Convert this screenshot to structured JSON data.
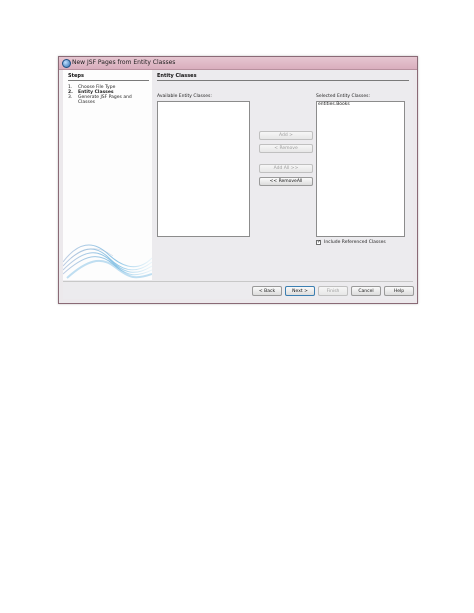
{
  "window": {
    "title": "New JSF Pages from Entity Classes"
  },
  "steps": {
    "title": "Steps",
    "items": [
      {
        "num": "1.",
        "label": "Choose File Type",
        "current": false
      },
      {
        "num": "2.",
        "label": "Entity Classes",
        "current": true
      },
      {
        "num": "3.",
        "label": "Generate JSF Pages and Classes",
        "current": false
      }
    ]
  },
  "panel": {
    "title": "Entity Classes",
    "available_label": "Available Entity Classes:",
    "available_items": [],
    "selected_label": "Selected Entity Classes:",
    "selected_items": [
      "entities.Books"
    ],
    "add_label": "Add >",
    "remove_label": "< Remove",
    "add_all_label": "Add All >>",
    "remove_all_label": "<< RemoveAll",
    "include_referenced_label": "Include Referenced Classes",
    "include_referenced_checked": true,
    "checkmark": "✓"
  },
  "footer": {
    "back_label": "< Back",
    "next_label": "Next >",
    "finish_label": "Finish",
    "cancel_label": "Cancel",
    "help_label": "Help"
  },
  "colors": {
    "titlebar": "#d9aebd",
    "default_button_border": "#3c7fb1",
    "wave_accent": "#4aa3d9"
  },
  "icons": {
    "app": "netbeans-app-icon",
    "checkbox": "checkbox-checked-icon"
  }
}
